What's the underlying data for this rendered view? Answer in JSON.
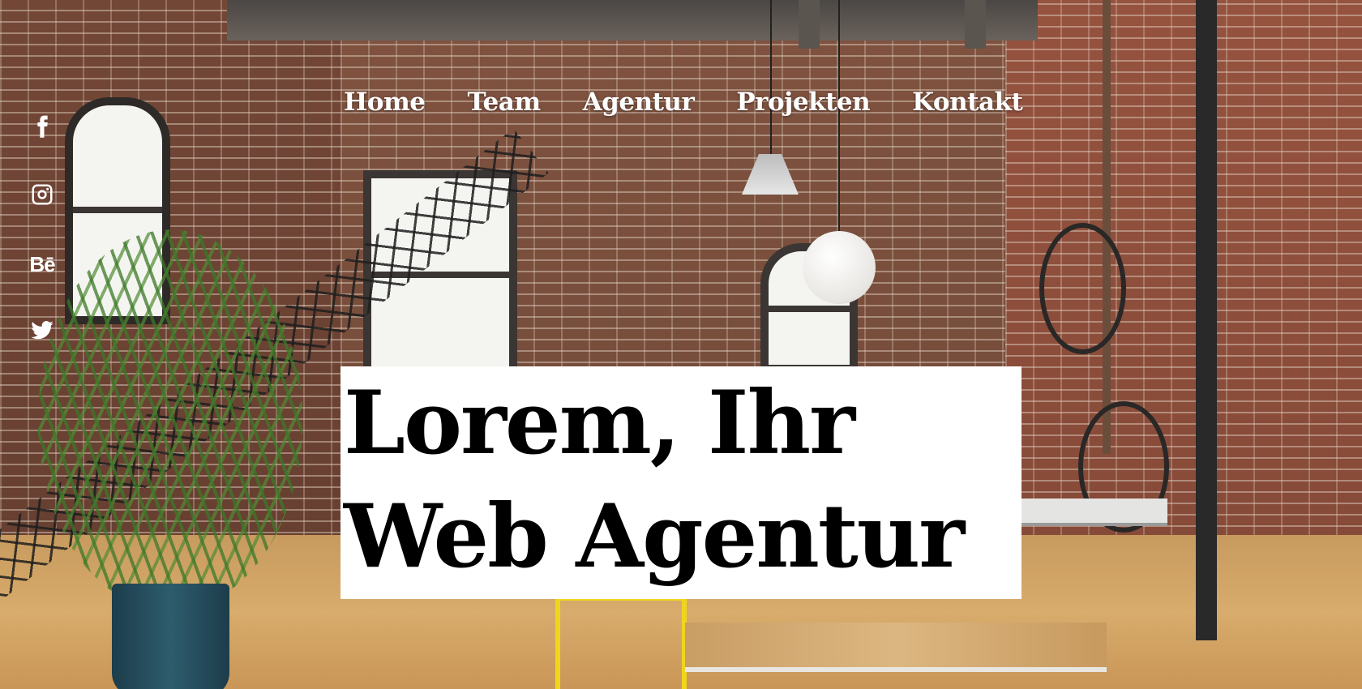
{
  "nav": {
    "items": [
      {
        "label": "Home"
      },
      {
        "label": "Team"
      },
      {
        "label": "Agentur"
      },
      {
        "label": "Projekten"
      },
      {
        "label": "Kontakt"
      }
    ]
  },
  "social": {
    "facebook": {
      "icon": "facebook-icon"
    },
    "instagram": {
      "icon": "instagram-icon"
    },
    "behance": {
      "icon": "behance-icon",
      "label": "Bē"
    },
    "twitter": {
      "icon": "twitter-icon"
    }
  },
  "hero": {
    "line1": "Lorem, Ihr",
    "line2": "Web Agentur"
  },
  "colors": {
    "nav_text": "#ffffff",
    "hero_background": "#ffffff",
    "hero_text": "#000000"
  }
}
